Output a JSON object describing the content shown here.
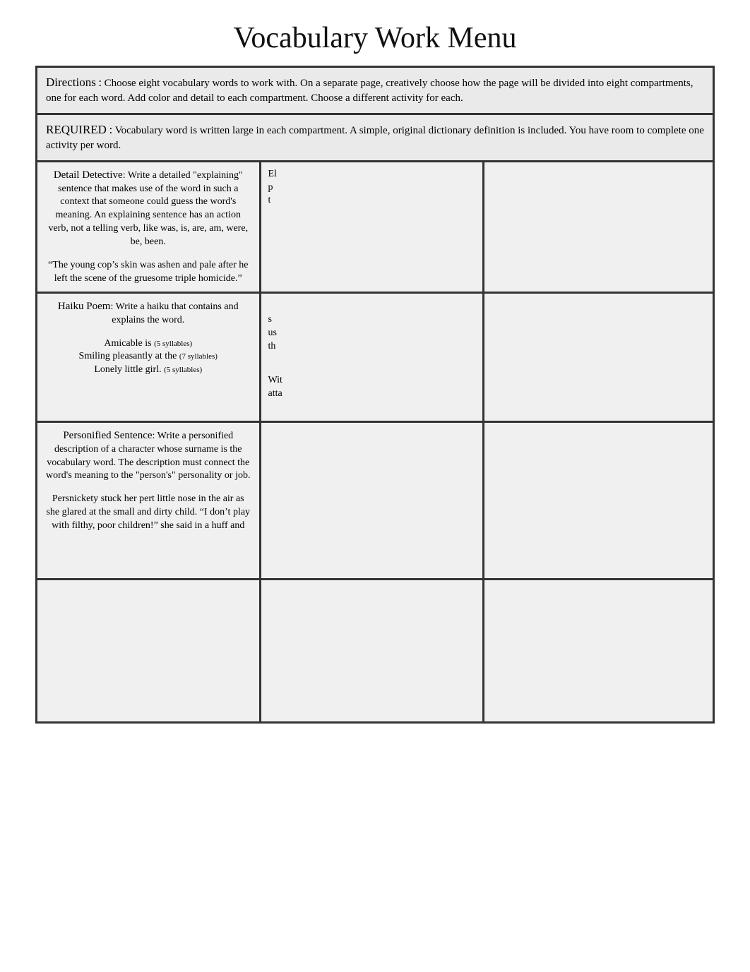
{
  "title": "Vocabulary Work Menu",
  "directions": {
    "label": "Directions",
    "sep": ":",
    "text": "Choose eight vocabulary words to work with. On a separate page, creatively choose how the page will be divided into eight compartments, one for each word. Add color and detail to each compartment. Choose a different activity for each."
  },
  "required": {
    "label": "REQUIRED",
    "sep": ":",
    "text": "Vocabulary word is written large in each compartment. A simple, original dictionary definition is included. You have room to complete one activity per word."
  },
  "cells": {
    "r1c1": {
      "title": "Detail Detective",
      "sep": ":",
      "desc": "Write a detailed \"explaining\" sentence that makes use of the word in such a context that someone could guess the word's meaning. An explaining sentence has an action verb, not a telling verb, like was, is, are, am, were, be, been.",
      "example": "“The young cop’s skin was ashen and pale after he left the scene of the gruesome triple homicide.”"
    },
    "r1c2": {
      "frag1": "El",
      "frag2": "p",
      "frag3": "t"
    },
    "r2c1": {
      "title": "Haiku Poem",
      "sep": ":",
      "desc": "Write a haiku that contains and explains the word.",
      "line1_word": "Amicable is",
      "line1_syll": "(5 syllables)",
      "line2_word": "Smiling pleasantly at the",
      "line2_syll": "(7 syllables)",
      "line3_word": "Lonely little girl.",
      "line3_syll": "(5 syllables)"
    },
    "r2c2": {
      "frag1": "s",
      "frag2": "us",
      "frag3": "th",
      "frag4": "Wit",
      "frag5": "atta"
    },
    "r3c1": {
      "title": "Personified Sentence",
      "sep": ":",
      "desc": "Write a personified description of a character whose surname is the vocabulary word. The description must connect the word's meaning to the \"person's\" personality or job.",
      "example": "Persnickety stuck her pert little nose in the air as she glared at the small and dirty child. “I don’t play with filthy, poor children!” she said in a huff and"
    }
  }
}
